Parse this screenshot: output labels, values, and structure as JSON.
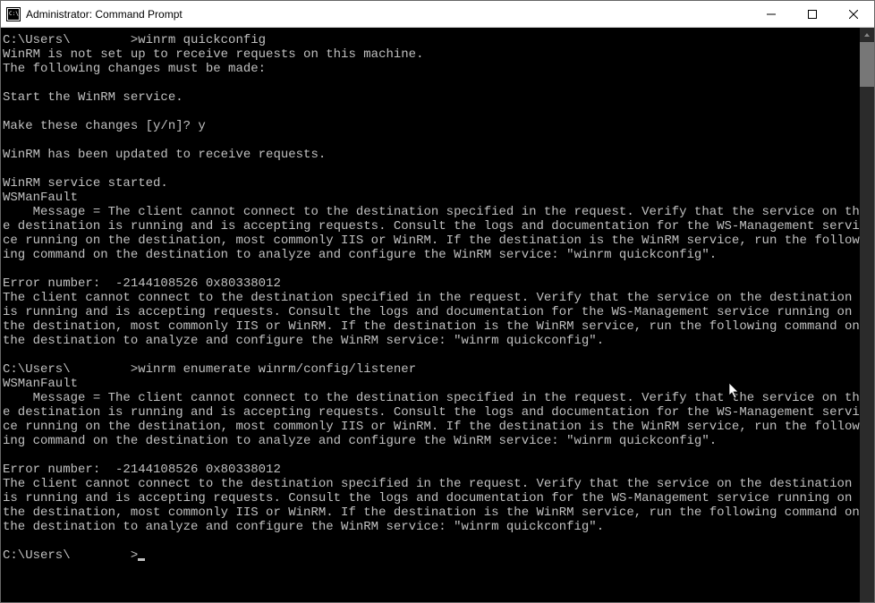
{
  "window": {
    "title": "Administrator: Command Prompt"
  },
  "terminal": {
    "prompt_prefix": "C:\\Users\\",
    "redacted1": "        ",
    "cmd1_full": ">winrm quickconfig",
    "line2": "WinRM is not set up to receive requests on this machine.",
    "line3": "The following changes must be made:",
    "line5": "Start the WinRM service.",
    "line7": "Make these changes [y/n]? y",
    "line9": "WinRM has been updated to receive requests.",
    "line11": "WinRM service started.",
    "line12": "WSManFault",
    "msg1a": "    Message = The client cannot connect to the destination specified in the request. Verify that the service on the destination is running and is accepting requests. Consult the logs and documentation for the WS-Management service running on the destination, most commonly IIS or WinRM. If the destination is the WinRM service, run the following command on the destination to analyze and configure the WinRM service: \"winrm quickconfig\".",
    "err1a": "Error number:  -2144108526 0x80338012",
    "err1b": "The client cannot connect to the destination specified in the request. Verify that the service on the destination is running and is accepting requests. Consult the logs and documentation for the WS-Management service running on the destination, most commonly IIS or WinRM. If the destination is the WinRM service, run the following command on the destination to analyze and configure the WinRM service: \"winrm quickconfig\".",
    "cmd2_full": ">winrm enumerate winrm/config/listener",
    "line_wsman2": "WSManFault",
    "msg2a": "    Message = The client cannot connect to the destination specified in the request. Verify that the service on the destination is running and is accepting requests. Consult the logs and documentation for the WS-Management service running on the destination, most commonly IIS or WinRM. If the destination is the WinRM service, run the following command on the destination to analyze and configure the WinRM service: \"winrm quickconfig\".",
    "err2a": "Error number:  -2144108526 0x80338012",
    "err2b": "The client cannot connect to the destination specified in the request. Verify that the service on the destination is running and is accepting requests. Consult the logs and documentation for the WS-Management service running on the destination, most commonly IIS or WinRM. If the destination is the WinRM service, run the following command on the destination to analyze and configure the WinRM service: \"winrm quickconfig\".",
    "prompt_end": ">"
  }
}
